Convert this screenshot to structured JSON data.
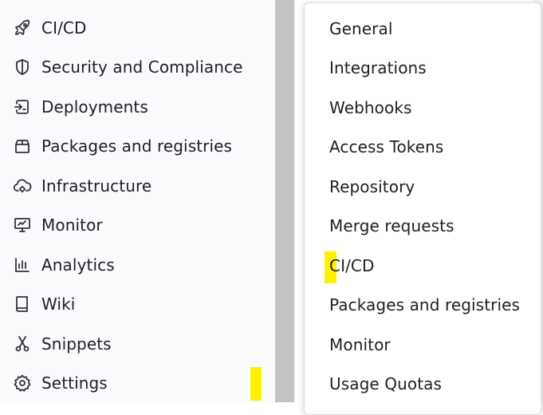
{
  "sidebar": {
    "items": [
      {
        "label": "CI/CD",
        "icon": "rocket-icon"
      },
      {
        "label": "Security and Compliance",
        "icon": "shield-icon"
      },
      {
        "label": "Deployments",
        "icon": "deployments-icon"
      },
      {
        "label": "Packages and registries",
        "icon": "package-icon"
      },
      {
        "label": "Infrastructure",
        "icon": "cloud-gear-icon"
      },
      {
        "label": "Monitor",
        "icon": "monitor-icon"
      },
      {
        "label": "Analytics",
        "icon": "chart-icon"
      },
      {
        "label": "Wiki",
        "icon": "book-icon"
      },
      {
        "label": "Snippets",
        "icon": "scissors-icon"
      },
      {
        "label": "Settings",
        "icon": "settings-icon"
      }
    ]
  },
  "flyout": {
    "items": [
      {
        "label": "General"
      },
      {
        "label": "Integrations"
      },
      {
        "label": "Webhooks"
      },
      {
        "label": "Access Tokens"
      },
      {
        "label": "Repository"
      },
      {
        "label": "Merge requests"
      },
      {
        "label": "CI/CD"
      },
      {
        "label": "Packages and registries"
      },
      {
        "label": "Monitor"
      },
      {
        "label": "Usage Quotas"
      }
    ]
  },
  "colors": {
    "sidebar_bg": "#fbfafd",
    "text": "#1f1e24",
    "highlight": "#fff200",
    "gutter": "#c4c4c4"
  }
}
